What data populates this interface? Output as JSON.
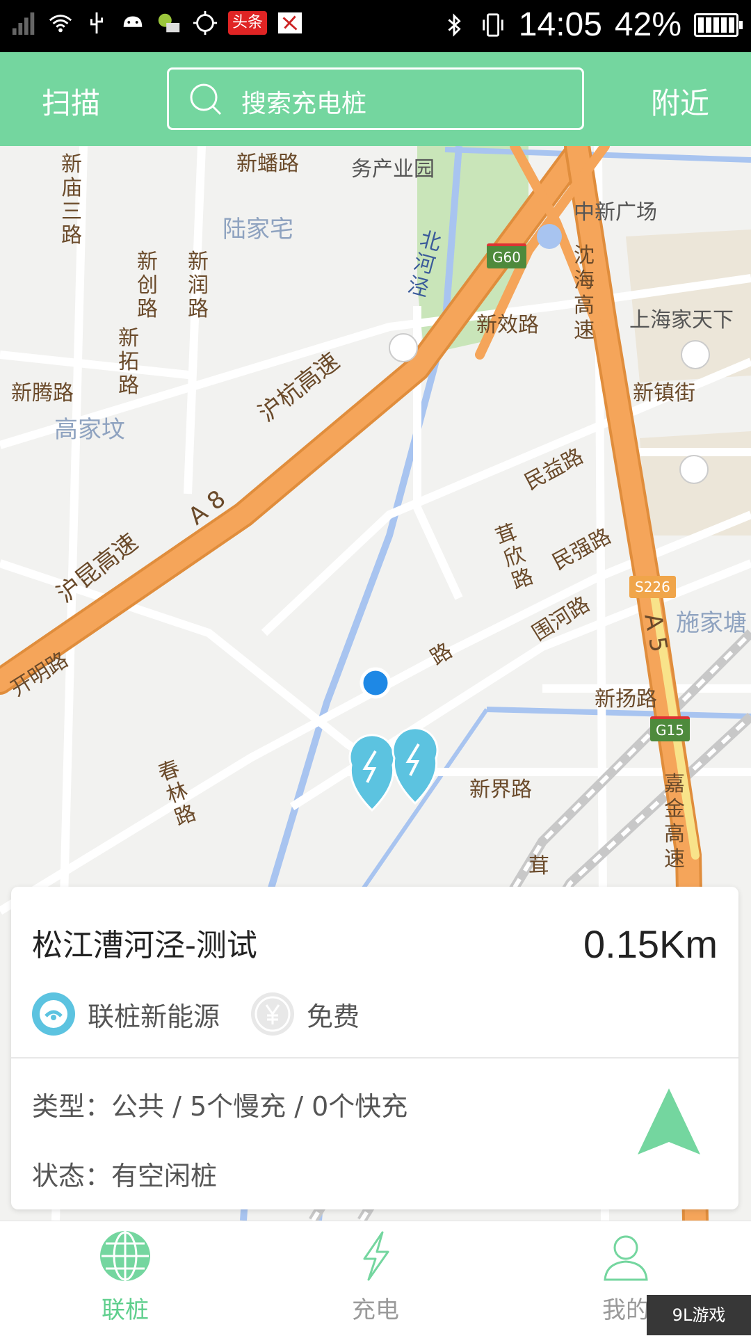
{
  "status_bar": {
    "time": "14:05",
    "battery": "42%",
    "notification_badge": "头条"
  },
  "header": {
    "scan_label": "扫描",
    "search_placeholder": "搜索充电桩",
    "nearby_label": "附近"
  },
  "map": {
    "labels": {
      "xinpan_road": "新蟠路",
      "wuchan_park": "务产业园",
      "xinmiao_3rd": "新庙三路",
      "lujiazhai": "陆家宅",
      "xinchuang_road": "新创路",
      "xinrun_road": "新润路",
      "xintuo_road": "新拓路",
      "xinteng_road": "新腾路",
      "gaojiafen": "高家坟",
      "beihejing": "北河泾",
      "zhongxin_plaza": "中新广场",
      "shenhai_hw": "沈海高速",
      "shanghai_jiatianxia": "上海家天下",
      "xinxiao_road": "新效路",
      "xinzhen_street": "新镇街",
      "huhang_hw": "沪杭高速",
      "a8": "A 8",
      "hukun_hw": "沪昆高速",
      "minyi_road": "民益路",
      "qixin_road": "茸欣路",
      "minqiang_road": "民强路",
      "weihe_road": "围河路",
      "shijiatang": "施家塘",
      "a5": "A 5",
      "kaiming_road": "开明路",
      "xinyang_road": "新扬路",
      "chunlin_road": "春林路",
      "xinjie_road": "新界路",
      "jiajin_hw": "嘉金高速",
      "qi_partial": "茸",
      "lu_partial": "路"
    },
    "shields": {
      "g60": "G60",
      "s226": "S226",
      "g15": "G15"
    },
    "colors": {
      "highway": "#f5a55a",
      "water": "#a8c4f0",
      "park": "#c9e5b9",
      "pin": "#5cc3e0",
      "location": "#1e88e5"
    }
  },
  "station_card": {
    "name": "松江漕河泾-测试",
    "distance": "0.15Km",
    "operator": "联桩新能源",
    "fee": "免费",
    "type_line": "类型：公共 / 5个慢充 / 0个快充",
    "status_line": "状态：有空闲桩"
  },
  "bottom_nav": {
    "tabs": [
      {
        "label": "联桩",
        "icon": "globe-icon"
      },
      {
        "label": "充电",
        "icon": "lightning-icon"
      },
      {
        "label": "我的",
        "icon": "user-icon"
      }
    ]
  },
  "watermark": "9L游戏"
}
